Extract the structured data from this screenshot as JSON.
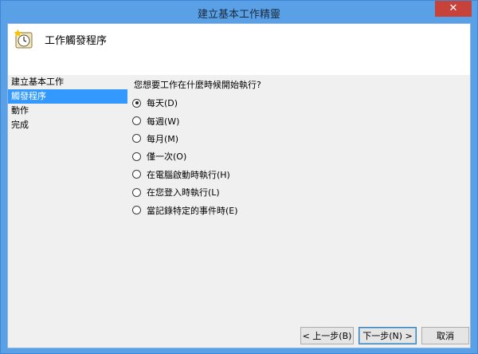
{
  "window": {
    "title": "建立基本工作精靈",
    "close_glyph": "✕"
  },
  "header": {
    "title": "工作觸發程序",
    "icon": "clock-icon"
  },
  "sidebar": {
    "items": [
      {
        "label": "建立基本工作",
        "active": false
      },
      {
        "label": "觸發程序",
        "active": true
      },
      {
        "label": "動作",
        "active": false
      },
      {
        "label": "完成",
        "active": false
      }
    ]
  },
  "main": {
    "question": "您想要工作在什麼時候開始執行?",
    "options": [
      {
        "label": "每天(D)",
        "checked": true
      },
      {
        "label": "每週(W)",
        "checked": false
      },
      {
        "label": "每月(M)",
        "checked": false
      },
      {
        "label": "僅一次(O)",
        "checked": false
      },
      {
        "label": "在電腦啟動時執行(H)",
        "checked": false
      },
      {
        "label": "在您登入時執行(L)",
        "checked": false
      },
      {
        "label": "當記錄特定的事件時(E)",
        "checked": false
      }
    ]
  },
  "footer": {
    "back": "< 上一步(B)",
    "next": "下一步(N) >",
    "cancel": "取消"
  },
  "colors": {
    "titlebar": "#5aa0e6",
    "close": "#c7433a",
    "selection": "#3399ff"
  }
}
